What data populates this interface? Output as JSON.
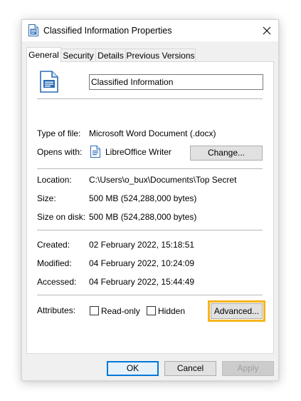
{
  "window": {
    "title": "Classified Information Properties",
    "title_icon": "document-icon",
    "close_icon": "close-icon"
  },
  "tabs": [
    {
      "label": "General",
      "active": true
    },
    {
      "label": "Security",
      "active": false
    },
    {
      "label": "Details",
      "active": false
    },
    {
      "label": "Previous Versions",
      "active": false
    }
  ],
  "general": {
    "file_icon": "writer-document-icon",
    "file_name": "Classified Information",
    "type_label": "Type of file:",
    "type_value": "Microsoft Word Document (.docx)",
    "opens_label": "Opens with:",
    "opens_icon": "libreoffice-writer-icon",
    "opens_value": "LibreOffice Writer",
    "change_button": "Change...",
    "location_label": "Location:",
    "location_value": "C:\\Users\\o_bux\\Documents\\Top Secret",
    "size_label": "Size:",
    "size_value": "500 MB (524,288,000 bytes)",
    "size_on_disk_label": "Size on disk:",
    "size_on_disk_value": "500 MB (524,288,000 bytes)",
    "created_label": "Created:",
    "created_value": "02 February 2022, 15:18:51",
    "modified_label": "Modified:",
    "modified_value": "04 February 2022, 10:24:09",
    "accessed_label": "Accessed:",
    "accessed_value": "04 February 2022, 15:44:49",
    "attributes_label": "Attributes:",
    "readonly_label": "Read-only",
    "readonly_checked": false,
    "hidden_label": "Hidden",
    "hidden_checked": false,
    "advanced_button": "Advanced...",
    "highlight_color": "#f7b51b"
  },
  "footer": {
    "ok": "OK",
    "cancel": "Cancel",
    "apply": "Apply"
  }
}
